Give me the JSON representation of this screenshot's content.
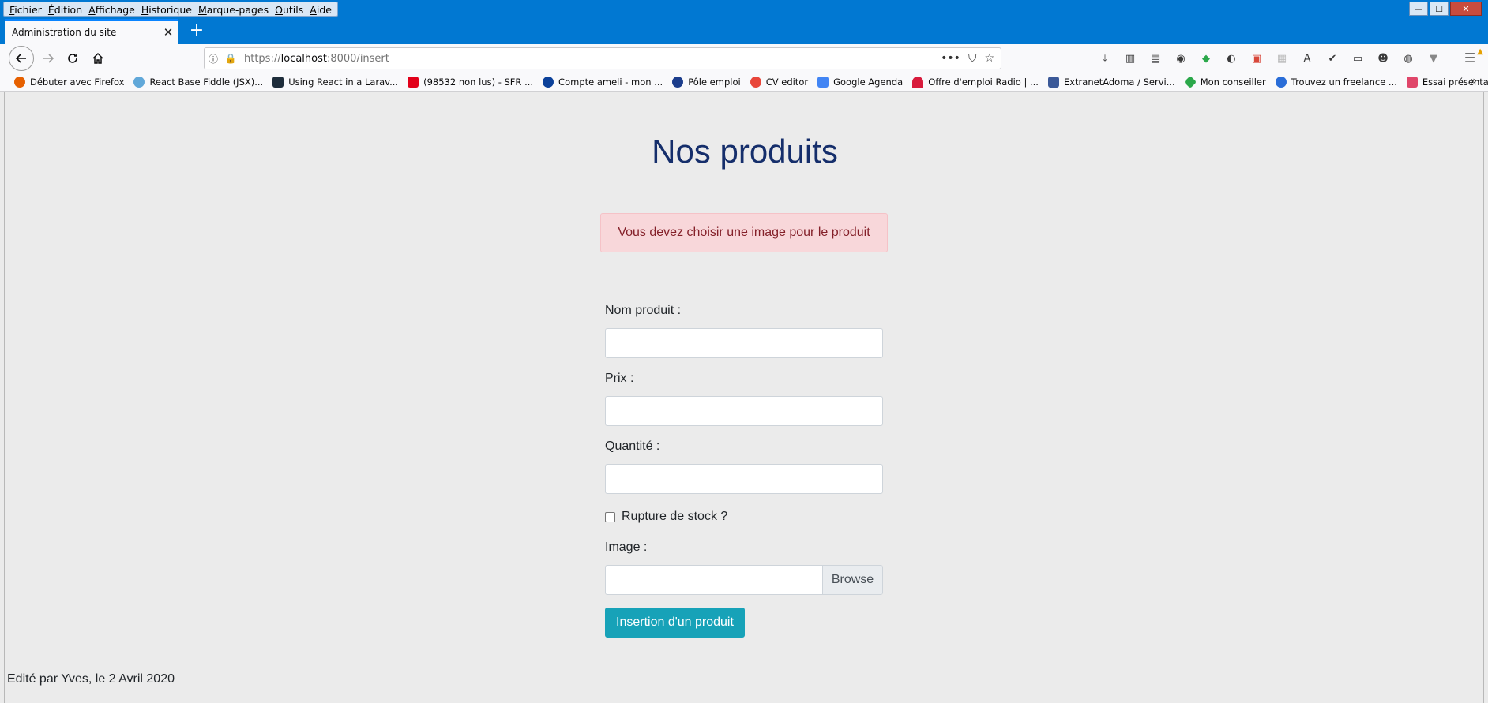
{
  "menubar": {
    "items": [
      "Fichier",
      "Édition",
      "Affichage",
      "Historique",
      "Marque-pages",
      "Outils",
      "Aide"
    ]
  },
  "tab": {
    "title": "Administration du site",
    "close": "✕",
    "new_tab": "+"
  },
  "urlbar": {
    "scheme": "https://",
    "host": "localhost",
    "path": ":8000/insert"
  },
  "bookmarks": [
    {
      "label": "Débuter avec Firefox",
      "color": "#e66000"
    },
    {
      "label": "React Base Fiddle (JSX)...",
      "color": "#61a8d9"
    },
    {
      "label": "Using React in a Larav...",
      "color": "#1e2d3b"
    },
    {
      "label": "(98532 non lus) - SFR ...",
      "color": "#e2001a"
    },
    {
      "label": "Compte ameli - mon ...",
      "color": "#0c419a"
    },
    {
      "label": "Pôle emploi",
      "color": "#1c3d8c"
    },
    {
      "label": "CV editor",
      "color": "#e8463a"
    },
    {
      "label": "Google Agenda",
      "color": "#4285f4"
    },
    {
      "label": "Offre d'emploi Radio | ...",
      "color": "#d81b3c"
    },
    {
      "label": "ExtranetAdoma / Servi...",
      "color": "#3b5998"
    },
    {
      "label": "Mon conseiller",
      "color": "#2ba84a"
    },
    {
      "label": "Trouvez un freelance ...",
      "color": "#2a6dd8"
    },
    {
      "label": "Essai présentation",
      "color": "#e0466a"
    }
  ],
  "page": {
    "title": "Nos produits",
    "alert": "Vous devez choisir une image pour le produit",
    "form": {
      "name_label": "Nom produit :",
      "price_label": "Prix :",
      "quantity_label": "Quantité :",
      "stock_label": "Rupture de stock ?",
      "image_label": "Image :",
      "browse_label": "Browse",
      "submit_label": "Insertion d'un produit"
    },
    "footer": "Edité par Yves, le 2 Avril 2020"
  },
  "colors": {
    "title": "#152e6b",
    "alert_bg": "#f8d7da",
    "alert_text": "#842029",
    "submit_bg": "#17a2b8",
    "chrome_blue": "#0178d2"
  }
}
